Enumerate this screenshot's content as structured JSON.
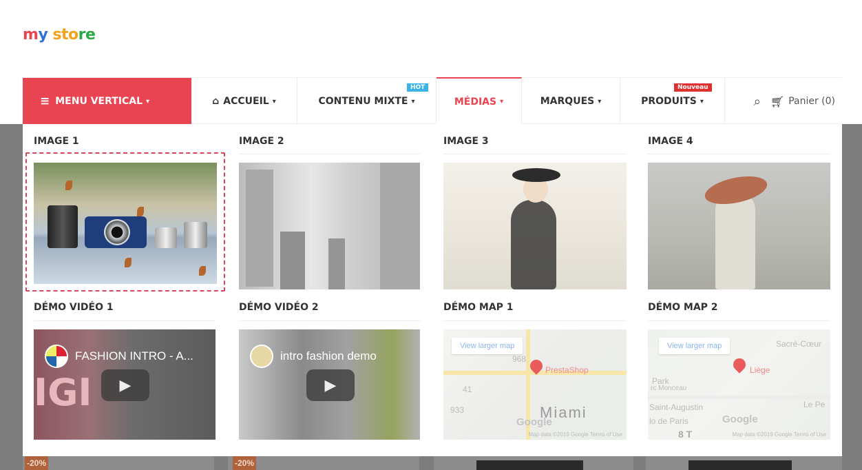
{
  "logo": {
    "part1": "m",
    "part2": "y",
    "part3": " sto",
    "part4": "re"
  },
  "nav": {
    "vertical_menu": "MENU VERTICAL",
    "items": [
      {
        "label": "ACCUEIL",
        "icon": "home-icon"
      },
      {
        "label": "CONTENU MIXTE",
        "badge": "HOT"
      },
      {
        "label": "MÉDIAS"
      },
      {
        "label": "MARQUES"
      },
      {
        "label": "PRODUITS",
        "badge": "Nouveau"
      }
    ],
    "cart_label": "Panier (0)",
    "accent_color": "#e94452"
  },
  "mega_menu": {
    "columns": [
      {
        "title": "IMAGE 1"
      },
      {
        "title": "IMAGE 2"
      },
      {
        "title": "IMAGE 3"
      },
      {
        "title": "IMAGE 4"
      }
    ],
    "row2": [
      {
        "title": "DÉMO VIDÉO 1",
        "video_title": "FASHION INTRO - A...",
        "overlay_text": "IGI"
      },
      {
        "title": "DÉMO VIDÉO 2",
        "video_title": "intro fashion demo"
      },
      {
        "title": "DÉMO MAP 1",
        "view_larger": "View larger map",
        "place": "PrestaShop",
        "city": "Miami",
        "google": "Google",
        "footer": "Map data ©2019 Google   Terms of Use",
        "route1": "968",
        "route2": "41",
        "route3": "933"
      },
      {
        "title": "DÉMO MAP 2",
        "view_larger": "View larger map",
        "place": "Liège",
        "l1": "Sacré-Cœur",
        "l2": "Park",
        "l3": "rc Monceau",
        "l4": "Saint-Augustin",
        "l5": "Le Pe",
        "l6": "lo de Paris",
        "l7": "8 T",
        "google": "Google",
        "footer": "Map data ©2019 Google   Terms of Use"
      }
    ]
  },
  "background": {
    "badge1": "-20%",
    "badge2": "-20%"
  }
}
